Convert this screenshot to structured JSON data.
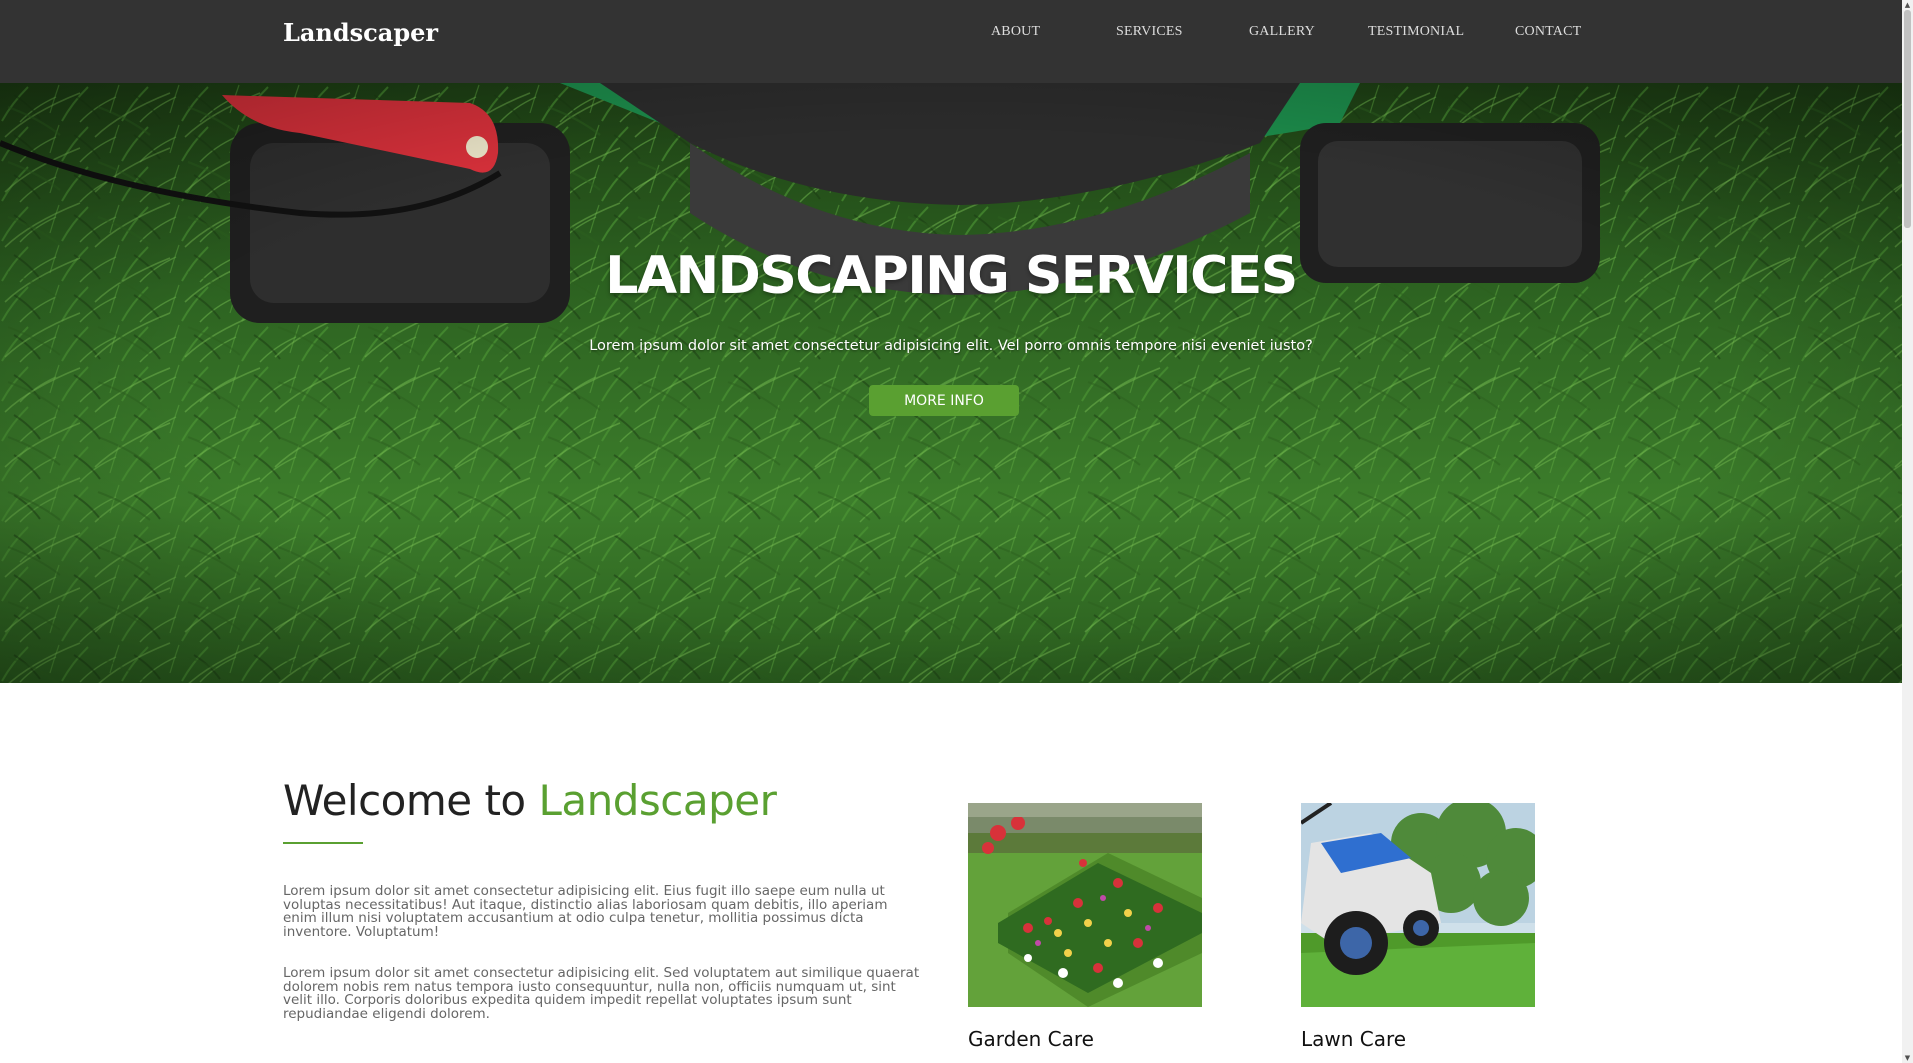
{
  "nav": {
    "brand": "Landscaper",
    "links": [
      "ABOUT",
      "SERVICES",
      "GALLERY",
      "TESTIMONIAL",
      "CONTACT"
    ]
  },
  "hero": {
    "title": "LANDSCAPING SERVICES",
    "subtitle": "Lorem ipsum dolor sit amet consectetur adipisicing elit. Vel porro omnis tempore nisi eveniet iusto?",
    "button": "MORE INFO"
  },
  "welcome": {
    "title_prefix": "Welcome to",
    "title_accent": "Landscaper",
    "paragraph1": "Lorem ipsum dolor sit amet consectetur adipisicing elit. Eius fugit illo saepe eum nulla ut voluptas necessitatibus! Aut itaque, distinctio alias laboriosam quam debitis, illo aperiam enim illum nisi voluptatem accusantium at odio culpa tenetur, mollitia possimus dicta inventore. Voluptatum!",
    "paragraph2": "Lorem ipsum dolor sit amet consectetur adipisicing elit. Sed voluptatem aut similique quaerat dolorem nobis rem natus tempora iusto consequuntur, nulla non, officiis numquam ut, sint velit illo. Corporis doloribus expedita quidem impedit repellat voluptates ipsum sunt repudiandae eligendi dolorem."
  },
  "services": [
    {
      "title": "Garden Care"
    },
    {
      "title": "Lawn Care"
    }
  ],
  "colors": {
    "nav_bg": "#333333",
    "accent": "#5aa031",
    "hero_grass": "#2f6b23"
  }
}
